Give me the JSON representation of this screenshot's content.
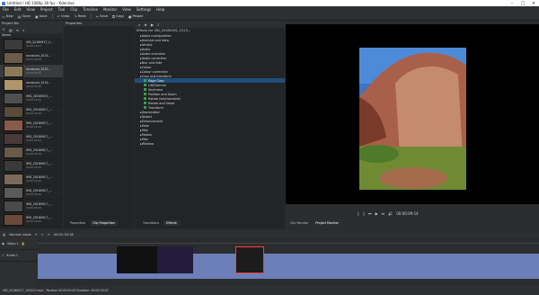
{
  "window": {
    "title": "Untitled / HD 1080p 30 fps - Kdenlive"
  },
  "menu": [
    "File",
    "Edit",
    "View",
    "Project",
    "Tool",
    "Clip",
    "Timeline",
    "Monitor",
    "View",
    "Settings",
    "Help"
  ],
  "toolbar": {
    "new": "New",
    "open": "Open",
    "save": "Save",
    "undo": "Undo",
    "redo": "Redo",
    "save2": "Save",
    "copy": "Copy",
    "people": "People"
  },
  "project_bin": {
    "title": "Project Bin",
    "column": "Name",
    "clips": [
      {
        "name": "VID_20180917_1...",
        "dur": "00:00:16:07"
      },
      {
        "name": "rocsbund_1015...",
        "dur": "00:00:08:09"
      },
      {
        "name": "rocsbund_1015...",
        "dur": "00:00:05:00"
      },
      {
        "name": "rocsbund_1015...",
        "dur": "00:00:05:00"
      },
      {
        "name": "IMG_20180915_...",
        "dur": "00:00:05:00"
      },
      {
        "name": "IMG_20180917_...",
        "dur": "00:00:05:00"
      },
      {
        "name": "IMG_20180917_...",
        "dur": "00:00:05:00"
      },
      {
        "name": "IMG_20180917_...",
        "dur": "00:00:05:00"
      },
      {
        "name": "IMG_20180917_...",
        "dur": "00:00:05:00"
      },
      {
        "name": "IMG_20180917_...",
        "dur": "00:00:05:00"
      },
      {
        "name": "IMG_20180917_...",
        "dur": "00:00:05:00"
      },
      {
        "name": "IMG_20180917_...",
        "dur": "00:00:05:00"
      },
      {
        "name": "IMG_20180917_...",
        "dur": "00:00:05:00"
      },
      {
        "name": "IMG_20180917_...",
        "dur": "00:00:05:00"
      }
    ]
  },
  "clip_props": {
    "title": "Properties",
    "tabs": [
      "Properties",
      "Clip Properties"
    ]
  },
  "effects": {
    "title": "Effects for VID_20180192_1013...",
    "items": [
      {
        "label": "Alpha manipulation",
        "sub": false,
        "sel": false
      },
      {
        "label": "Analysis and data",
        "sub": false,
        "sel": false
      },
      {
        "label": "Artistic",
        "sub": false,
        "sel": false
      },
      {
        "label": "Audio",
        "sub": false,
        "sel": false
      },
      {
        "label": "Audio channels",
        "sub": false,
        "sel": false
      },
      {
        "label": "Audio correction",
        "sub": false,
        "sel": false
      },
      {
        "label": "Blur and hide",
        "sub": false,
        "sel": false
      },
      {
        "label": "Colour",
        "sub": false,
        "sel": false
      },
      {
        "label": "Colour correction",
        "sub": false,
        "sel": false
      },
      {
        "label": "Crop and transform",
        "sub": false,
        "sel": false
      },
      {
        "label": "Edge Crop",
        "sub": true,
        "sel": true
      },
      {
        "label": "Lift/Gamma",
        "sub": true,
        "sel": false
      },
      {
        "label": "Keyframe",
        "sub": true,
        "sel": false
      },
      {
        "label": "Position and Zoom",
        "sub": true,
        "sel": false
      },
      {
        "label": "Rotate (keyframable)",
        "sub": true,
        "sel": false
      },
      {
        "label": "Rotate and Shear",
        "sub": true,
        "sel": false
      },
      {
        "label": "Transform",
        "sub": true,
        "sel": false
      },
      {
        "label": "Deprecated",
        "sub": false,
        "sel": false
      },
      {
        "label": "Distort",
        "sub": false,
        "sel": false
      },
      {
        "label": "Enhancement",
        "sub": false,
        "sel": false
      },
      {
        "label": "Fade",
        "sub": false,
        "sel": false
      },
      {
        "label": "Misc",
        "sub": false,
        "sel": false
      },
      {
        "label": "Motion",
        "sub": false,
        "sel": false
      },
      {
        "label": "Misc",
        "sub": false,
        "sel": false
      },
      {
        "label": "Window",
        "sub": false,
        "sel": false
      }
    ],
    "tabs": [
      "Transitions",
      "Effects"
    ]
  },
  "monitor": {
    "tabs": [
      "Clip Monitor",
      "Project Monitor"
    ],
    "timecode": "00:00:09:14"
  },
  "timeline": {
    "mode": "Normal mode",
    "timecode": "00:01:35:18",
    "tracks": [
      "Video 1",
      "Audio 1"
    ]
  },
  "status": {
    "text": "VID_20180917_102022.mp4 - Position 00:00:00:00 Duration: 00:00:16:07"
  }
}
